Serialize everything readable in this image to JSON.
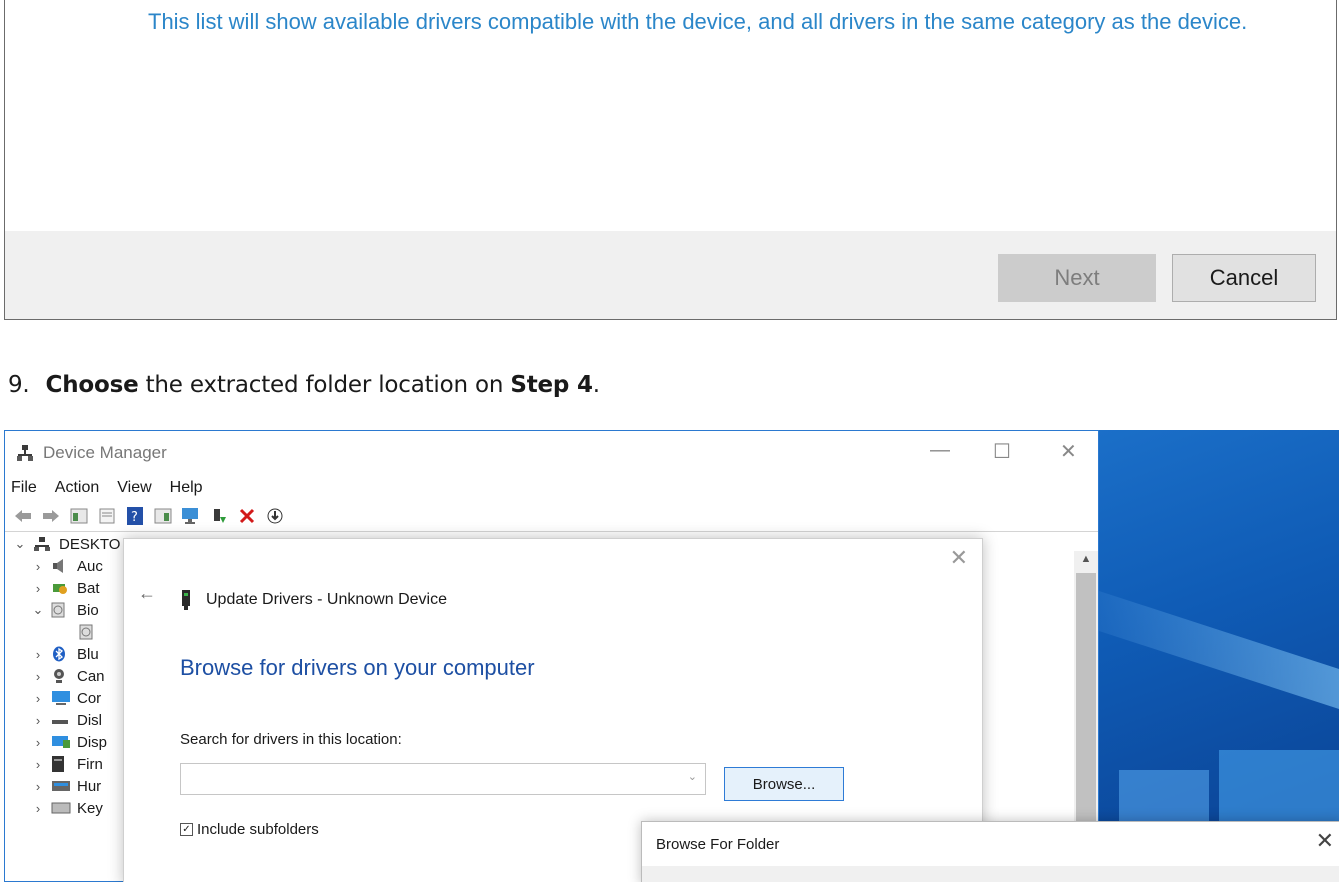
{
  "top_wizard": {
    "description": "This list will show available drivers compatible with the device, and all drivers in the same category as the device.",
    "next_label": "Next",
    "cancel_label": "Cancel"
  },
  "instruction": {
    "number": "9.",
    "bold1": "Choose",
    "text1": " the extracted folder location on ",
    "bold2": "Step 4",
    "text2": "."
  },
  "device_manager": {
    "title": "Device Manager",
    "menu": [
      "File",
      "Action",
      "View",
      "Help"
    ],
    "tree": [
      {
        "label": "DESKTO",
        "chev": "⌄",
        "icon": "computer-icon"
      },
      {
        "label": "Auc",
        "chev": "›",
        "icon": "audio-icon"
      },
      {
        "label": "Bat",
        "chev": "›",
        "icon": "battery-icon"
      },
      {
        "label": "Bio",
        "chev": "⌄",
        "icon": "biometric-icon"
      },
      {
        "label": "",
        "chev": "",
        "icon": "fingerprint-icon"
      },
      {
        "label": "Blu",
        "chev": "›",
        "icon": "bluetooth-icon"
      },
      {
        "label": "Can",
        "chev": "›",
        "icon": "camera-icon"
      },
      {
        "label": "Cor",
        "chev": "›",
        "icon": "monitor-icon"
      },
      {
        "label": "Disl",
        "chev": "›",
        "icon": "disk-icon"
      },
      {
        "label": "Disp",
        "chev": "›",
        "icon": "display-icon"
      },
      {
        "label": "Firn",
        "chev": "›",
        "icon": "firmware-icon"
      },
      {
        "label": "Hur",
        "chev": "›",
        "icon": "hid-icon"
      },
      {
        "label": "Key",
        "chev": "›",
        "icon": "keyboard-icon"
      }
    ]
  },
  "update_dialog": {
    "header": "Update Drivers - Unknown Device",
    "heading": "Browse for drivers on your computer",
    "label": "Search for drivers in this location:",
    "path_value": "",
    "browse_label": "Browse...",
    "include_subfolders": "Include subfolders",
    "include_checked": true
  },
  "browse_folder_dialog": {
    "title": "Browse For Folder"
  },
  "colors": {
    "link_blue": "#2b86c9",
    "heading_blue": "#1d4fa3",
    "accent": "#2e7bd6"
  }
}
